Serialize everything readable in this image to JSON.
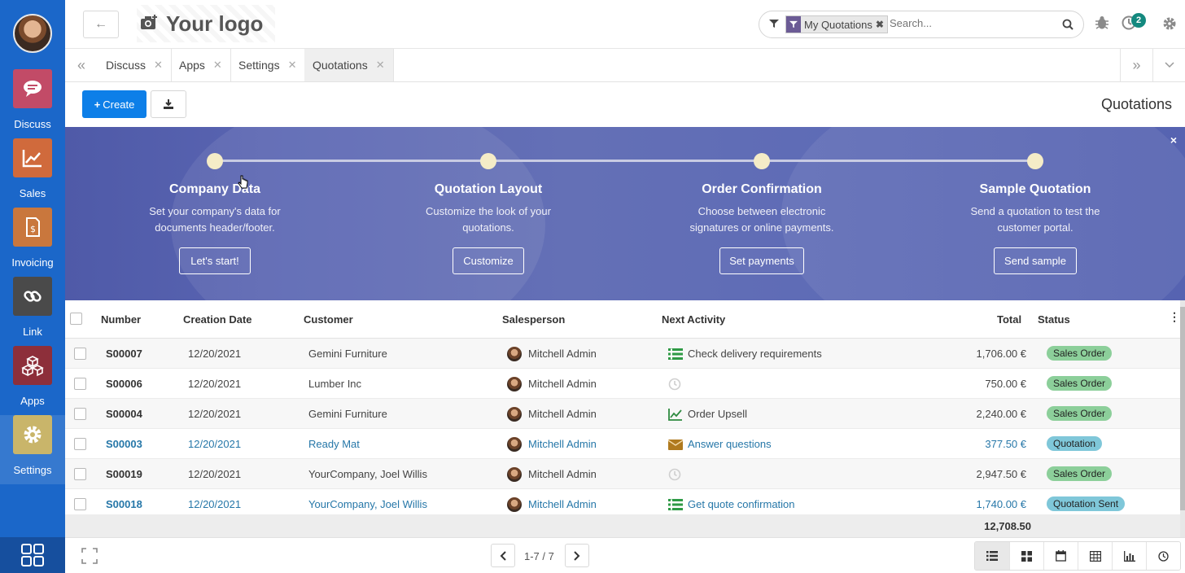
{
  "sidebar": {
    "items": [
      {
        "label": "Discuss",
        "color": "#c24b67"
      },
      {
        "label": "Sales",
        "color": "#d06a3c"
      },
      {
        "label": "Invoicing",
        "color": "#c9773d"
      },
      {
        "label": "Link",
        "color": "#4a4a4a"
      },
      {
        "label": "Apps",
        "color": "#8d2f3a"
      },
      {
        "label": "Settings",
        "color": "#c9b56a"
      }
    ]
  },
  "header": {
    "logo_text": "Your logo",
    "search": {
      "facet_label": "My Quotations",
      "placeholder": "Search..."
    },
    "activity_count": "2"
  },
  "tabs": [
    {
      "label": "Discuss"
    },
    {
      "label": "Apps"
    },
    {
      "label": "Settings"
    },
    {
      "label": "Quotations"
    }
  ],
  "control": {
    "create_label": "Create",
    "title": "Quotations"
  },
  "onboarding": {
    "close": "×",
    "steps": [
      {
        "title": "Company Data",
        "desc1": "Set your company's data for",
        "desc2": "documents header/footer.",
        "button": "Let's start!"
      },
      {
        "title": "Quotation Layout",
        "desc1": "Customize the look of your",
        "desc2": "quotations.",
        "button": "Customize"
      },
      {
        "title": "Order Confirmation",
        "desc1": "Choose between electronic",
        "desc2": "signatures or online payments.",
        "button": "Set payments"
      },
      {
        "title": "Sample Quotation",
        "desc1": "Send a quotation to test the",
        "desc2": "customer portal.",
        "button": "Send sample"
      }
    ]
  },
  "table": {
    "headers": {
      "number": "Number",
      "creation_date": "Creation Date",
      "customer": "Customer",
      "salesperson": "Salesperson",
      "next_activity": "Next Activity",
      "total": "Total",
      "status": "Status"
    },
    "rows": [
      {
        "number": "S00007",
        "date": "12/20/2021",
        "customer": "Gemini Furniture",
        "salesperson": "Mitchell Admin",
        "activity": "Check delivery requirements",
        "activity_icon": "list-icon",
        "total": "1,706.00 €",
        "status": "Sales Order"
      },
      {
        "number": "S00006",
        "date": "12/20/2021",
        "customer": "Lumber Inc",
        "salesperson": "Mitchell Admin",
        "activity": "",
        "activity_icon": "clock-icon",
        "total": "750.00 €",
        "status": "Sales Order"
      },
      {
        "number": "S00004",
        "date": "12/20/2021",
        "customer": "Gemini Furniture",
        "salesperson": "Mitchell Admin",
        "activity": "Order Upsell",
        "activity_icon": "chart-icon",
        "total": "2,240.00 €",
        "status": "Sales Order"
      },
      {
        "number": "S00003",
        "date": "12/20/2021",
        "customer": "Ready Mat",
        "salesperson": "Mitchell Admin",
        "activity": "Answer questions",
        "activity_icon": "envelope-icon",
        "total": "377.50 €",
        "status": "Quotation"
      },
      {
        "number": "S00019",
        "date": "12/20/2021",
        "customer": "YourCompany, Joel Willis",
        "salesperson": "Mitchell Admin",
        "activity": "",
        "activity_icon": "clock-icon",
        "total": "2,947.50 €",
        "status": "Sales Order"
      },
      {
        "number": "S00018",
        "date": "12/20/2021",
        "customer": "YourCompany, Joel Willis",
        "salesperson": "Mitchell Admin",
        "activity": "Get quote confirmation",
        "activity_icon": "list-icon",
        "total": "1,740.00 €",
        "status": "Quotation Sent"
      }
    ],
    "sum_total": "12,708.50"
  },
  "pager": {
    "value": "1-7 / 7"
  },
  "colors": {
    "sidebar": "#1b67c9",
    "primary_button": "#0d7fe8",
    "status_sales_order": "#8ccf9a",
    "status_quotation": "#7fc7d9",
    "link_blue": "#2677a8"
  }
}
